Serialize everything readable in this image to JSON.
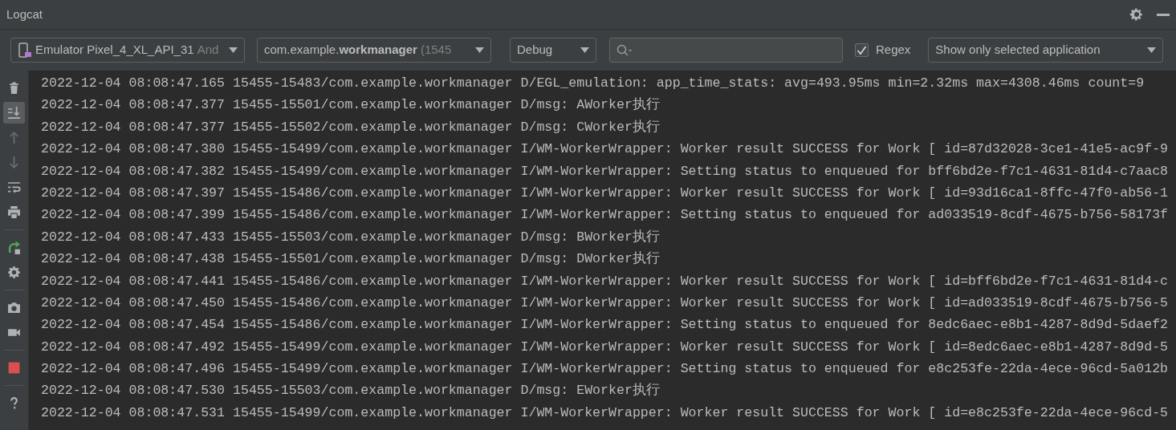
{
  "window": {
    "title": "Logcat"
  },
  "toolbar": {
    "device": {
      "name": "Emulator Pixel_4_XL_API_31",
      "suffix": "And"
    },
    "process": {
      "name": "com.example.**workmanager**",
      "suffix": "(1545"
    },
    "log_level": "Debug",
    "regex": {
      "label": "Regex",
      "checked": true
    },
    "filter": "Show only selected application"
  },
  "side_tools": [
    {
      "kind": "trash",
      "selected": false,
      "disabled": false
    },
    {
      "kind": "scroll-end",
      "selected": true,
      "disabled": false
    },
    {
      "kind": "up",
      "selected": false,
      "disabled": true
    },
    {
      "kind": "down",
      "selected": false,
      "disabled": true
    },
    {
      "kind": "wrap",
      "selected": false,
      "disabled": false
    },
    {
      "kind": "print",
      "selected": false,
      "disabled": false
    },
    {
      "kind": "separator"
    },
    {
      "kind": "restart",
      "selected": false,
      "disabled": false
    },
    {
      "kind": "gear",
      "selected": false,
      "disabled": false
    },
    {
      "kind": "separator"
    },
    {
      "kind": "camera",
      "selected": false,
      "disabled": false
    },
    {
      "kind": "video",
      "selected": false,
      "disabled": false
    },
    {
      "kind": "separator"
    },
    {
      "kind": "stop",
      "selected": false,
      "disabled": false
    },
    {
      "kind": "separator"
    },
    {
      "kind": "help",
      "selected": false,
      "disabled": false
    }
  ],
  "log_lines": [
    "2022-12-04 08:08:47.165 15455-15483/com.example.workmanager D/EGL_emulation: app_time_stats: avg=493.95ms min=2.32ms max=4308.46ms count=9",
    "2022-12-04 08:08:47.377 15455-15501/com.example.workmanager D/msg: AWorker执行",
    "2022-12-04 08:08:47.377 15455-15502/com.example.workmanager D/msg: CWorker执行",
    "2022-12-04 08:08:47.380 15455-15499/com.example.workmanager I/WM-WorkerWrapper: Worker result SUCCESS for Work [ id=87d32028-3ce1-41e5-ac9f-9",
    "2022-12-04 08:08:47.382 15455-15499/com.example.workmanager I/WM-WorkerWrapper: Setting status to enqueued for bff6bd2e-f7c1-4631-81d4-c7aac8",
    "2022-12-04 08:08:47.397 15455-15486/com.example.workmanager I/WM-WorkerWrapper: Worker result SUCCESS for Work [ id=93d16ca1-8ffc-47f0-ab56-1",
    "2022-12-04 08:08:47.399 15455-15486/com.example.workmanager I/WM-WorkerWrapper: Setting status to enqueued for ad033519-8cdf-4675-b756-58173f",
    "2022-12-04 08:08:47.433 15455-15503/com.example.workmanager D/msg: BWorker执行",
    "2022-12-04 08:08:47.438 15455-15501/com.example.workmanager D/msg: DWorker执行",
    "2022-12-04 08:08:47.441 15455-15486/com.example.workmanager I/WM-WorkerWrapper: Worker result SUCCESS for Work [ id=bff6bd2e-f7c1-4631-81d4-c",
    "2022-12-04 08:08:47.450 15455-15486/com.example.workmanager I/WM-WorkerWrapper: Worker result SUCCESS for Work [ id=ad033519-8cdf-4675-b756-5",
    "2022-12-04 08:08:47.454 15455-15486/com.example.workmanager I/WM-WorkerWrapper: Setting status to enqueued for 8edc6aec-e8b1-4287-8d9d-5daef2",
    "2022-12-04 08:08:47.492 15455-15499/com.example.workmanager I/WM-WorkerWrapper: Worker result SUCCESS for Work [ id=8edc6aec-e8b1-4287-8d9d-5",
    "2022-12-04 08:08:47.496 15455-15499/com.example.workmanager I/WM-WorkerWrapper: Setting status to enqueued for e8c253fe-22da-4ece-96cd-5a012b",
    "2022-12-04 08:08:47.530 15455-15503/com.example.workmanager D/msg: EWorker执行",
    "2022-12-04 08:08:47.531 15455-15499/com.example.workmanager I/WM-WorkerWrapper: Worker result SUCCESS for Work [ id=e8c253fe-22da-4ece-96cd-5"
  ]
}
